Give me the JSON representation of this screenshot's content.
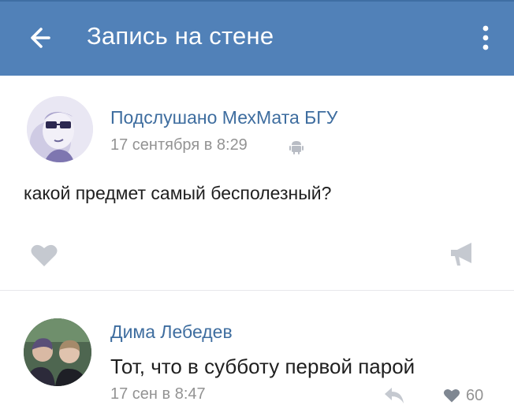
{
  "header": {
    "title": "Запись на стене",
    "back_icon": "arrow-left-icon",
    "menu_icon": "more-vertical-icon",
    "background": "#5181b8"
  },
  "post": {
    "author": "Подслушано МехМата БГУ",
    "date": "17 сентября в 8:29",
    "platform_icon": "android-icon",
    "text": "какой предмет самый бесполезный?",
    "like_icon": "heart-icon",
    "share_icon": "megaphone-icon"
  },
  "comment": {
    "author": "Дима Лебедев",
    "text": "Тот, что в субботу первой парой",
    "date": "17 сен в 8:47",
    "reply_icon": "reply-icon",
    "like_icon": "heart-icon",
    "likes": "60"
  },
  "colors": {
    "link": "#3e6d9f",
    "muted": "#939393",
    "icon_gray": "#c5c9d0"
  }
}
